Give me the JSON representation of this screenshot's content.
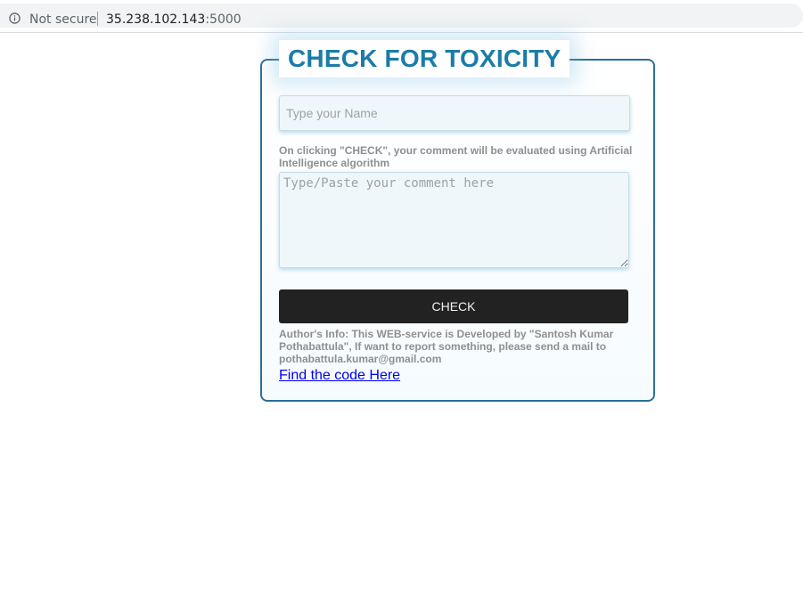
{
  "browser": {
    "security_label": "Not secure",
    "url_host": "35.238.102.143",
    "url_port": ":5000"
  },
  "form": {
    "title": "CHECK FOR TOXICITY",
    "name_placeholder": "Type your Name",
    "hint": "On clicking \"CHECK\", your comment will be evaluated using Artificial Intelligence algorithm",
    "comment_placeholder": "Type/Paste your comment here",
    "check_label": "CHECK",
    "author_info": "Author's Info: This WEB-service is Developed by \"Santosh Kumar Pothabattula\", If want to report something, please send a mail to pothabattula.kumar@gmail.com",
    "code_link_label": "Find the code Here"
  },
  "colors": {
    "title": "#1a7ca8",
    "box_border": "#2a6f99",
    "button_bg": "#222222",
    "link": "#0000ee",
    "muted_text": "#8f8f8f"
  },
  "icons": {
    "security": "info-circle-icon"
  }
}
